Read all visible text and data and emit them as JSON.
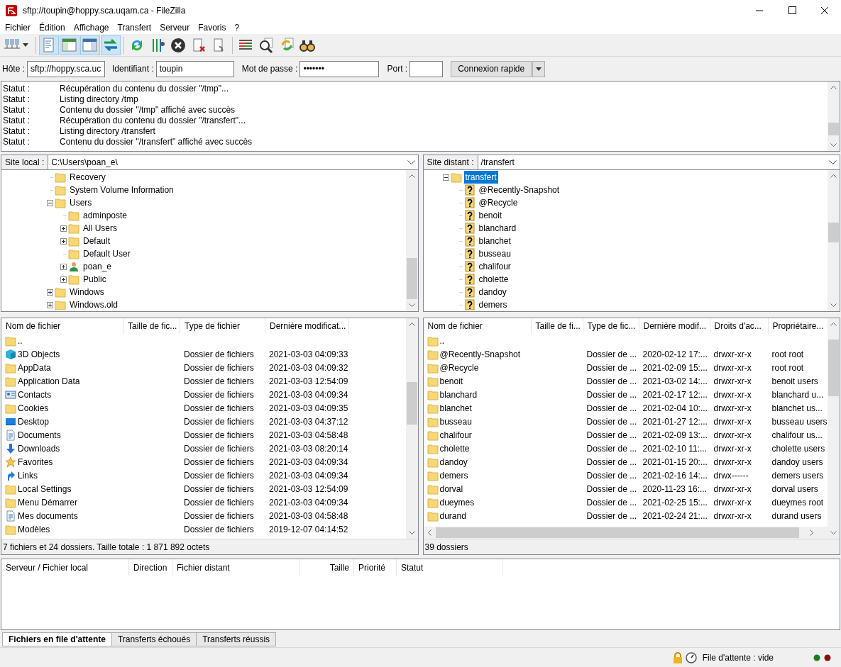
{
  "window": {
    "title": "sftp://toupin@hoppy.sca.uqam.ca - FileZilla"
  },
  "menu": [
    "Fichier",
    "Édition",
    "Affichage",
    "Transfert",
    "Serveur",
    "Favoris",
    "?"
  ],
  "toolbar": [
    {
      "kind": "sitemanager",
      "on": false
    },
    {
      "kind": "log",
      "on": true
    },
    {
      "kind": "localtree",
      "on": true
    },
    {
      "kind": "remotetree",
      "on": true
    },
    {
      "kind": "queue",
      "on": true
    },
    {
      "kind": "refresh",
      "on": false
    },
    {
      "kind": "filters",
      "on": false
    },
    {
      "kind": "cancel",
      "on": false
    },
    {
      "kind": "disconnect",
      "on": false
    },
    {
      "kind": "reconnect",
      "on": false
    },
    {
      "kind": "compare",
      "on": false
    },
    {
      "kind": "search",
      "on": false
    },
    {
      "kind": "sync",
      "on": false
    },
    {
      "kind": "find",
      "on": false
    }
  ],
  "quickconnect": {
    "host_label": "Hôte :",
    "host": "sftp://hoppy.sca.uc",
    "user_label": "Identifiant :",
    "user": "toupin",
    "password_label": "Mot de passe :",
    "password": "•••••••",
    "port_label": "Port :",
    "button": "Connexion rapide"
  },
  "log": [
    {
      "label": "Statut :",
      "message": "Récupération du contenu du dossier \"/tmp\"..."
    },
    {
      "label": "Statut :",
      "message": "Listing directory /tmp"
    },
    {
      "label": "Statut :",
      "message": "Contenu du dossier \"/tmp\" affiché avec succès"
    },
    {
      "label": "Statut :",
      "message": "Récupération du contenu du dossier \"/transfert\"..."
    },
    {
      "label": "Statut :",
      "message": "Listing directory /transfert"
    },
    {
      "label": "Statut :",
      "message": "Contenu du dossier \"/transfert\" affiché avec succès"
    }
  ],
  "local_site": {
    "label": "Site local :",
    "path": "C:\\Users\\poan_e\\",
    "tree": [
      {
        "name": "Recovery",
        "kind": "folder",
        "selected": false
      },
      {
        "name": "System Volume Information",
        "kind": "folder",
        "selected": false
      },
      {
        "name": "Users",
        "kind": "folder",
        "selected": false,
        "expanded": true,
        "children": [
          {
            "name": "adminposte",
            "kind": "folder",
            "selected": false
          },
          {
            "name": "All Users",
            "kind": "folder",
            "selected": false,
            "expanded": false
          },
          {
            "name": "Default",
            "kind": "folder",
            "selected": false,
            "expanded": false
          },
          {
            "name": "Default User",
            "kind": "folder",
            "selected": false
          },
          {
            "name": "poan_e",
            "kind": "user",
            "selected": false,
            "expanded": false
          },
          {
            "name": "Public",
            "kind": "folder",
            "selected": false,
            "expanded": false
          }
        ]
      },
      {
        "name": "Windows",
        "kind": "folder",
        "selected": false,
        "expanded": false
      },
      {
        "name": "Windows.old",
        "kind": "folder",
        "selected": false,
        "expanded": false
      }
    ],
    "columns": [
      "Nom de fichier",
      "Taille de fic...",
      "Type de fichier",
      "Dernière modificat..."
    ],
    "rows": [
      {
        "kind": "folder",
        "name": "..",
        "type": "",
        "modified": ""
      },
      {
        "kind": "cube",
        "name": "3D Objects",
        "type": "Dossier de fichiers",
        "modified": "2021-03-03 04:09:33"
      },
      {
        "kind": "folder",
        "name": "AppData",
        "type": "Dossier de fichiers",
        "modified": "2021-03-03 04:09:32"
      },
      {
        "kind": "folder",
        "name": "Application Data",
        "type": "Dossier de fichiers",
        "modified": "2021-03-03 12:54:09"
      },
      {
        "kind": "contacts",
        "name": "Contacts",
        "type": "Dossier de fichiers",
        "modified": "2021-03-03 04:09:34"
      },
      {
        "kind": "folder",
        "name": "Cookies",
        "type": "Dossier de fichiers",
        "modified": "2021-03-03 04:09:35"
      },
      {
        "kind": "desktop",
        "name": "Desktop",
        "type": "Dossier de fichiers",
        "modified": "2021-03-03 04:37:12"
      },
      {
        "kind": "document",
        "name": "Documents",
        "type": "Dossier de fichiers",
        "modified": "2021-03-03 04:58:48"
      },
      {
        "kind": "download",
        "name": "Downloads",
        "type": "Dossier de fichiers",
        "modified": "2021-03-03 08:20:14"
      },
      {
        "kind": "star",
        "name": "Favorites",
        "type": "Dossier de fichiers",
        "modified": "2021-03-03 04:09:34"
      },
      {
        "kind": "link",
        "name": "Links",
        "type": "Dossier de fichiers",
        "modified": "2021-03-03 04:09:34"
      },
      {
        "kind": "folder",
        "name": "Local Settings",
        "type": "Dossier de fichiers",
        "modified": "2021-03-03 12:54:09"
      },
      {
        "kind": "folder",
        "name": "Menu Démarrer",
        "type": "Dossier de fichiers",
        "modified": "2021-03-03 04:09:34"
      },
      {
        "kind": "document",
        "name": "Mes documents",
        "type": "Dossier de fichiers",
        "modified": "2021-03-03 04:58:48"
      },
      {
        "kind": "folder",
        "name": "Modèles",
        "type": "Dossier de fichiers",
        "modified": "2019-12-07 04:14:52"
      }
    ],
    "summary": "7 fichiers et 24 dossiers. Taille totale : 1 871 892 octets"
  },
  "remote_site": {
    "label": "Site distant :",
    "path": "/transfert",
    "tree": [
      {
        "name": "transfert",
        "kind": "folder",
        "selected": true,
        "expanded": true,
        "children": [
          {
            "name": "@Recently-Snapshot",
            "kind": "unknown",
            "selected": false
          },
          {
            "name": "@Recycle",
            "kind": "unknown",
            "selected": false
          },
          {
            "name": "benoit",
            "kind": "unknown",
            "selected": false
          },
          {
            "name": "blanchard",
            "kind": "unknown",
            "selected": false
          },
          {
            "name": "blanchet",
            "kind": "unknown",
            "selected": false
          },
          {
            "name": "busseau",
            "kind": "unknown",
            "selected": false
          },
          {
            "name": "chalifour",
            "kind": "unknown",
            "selected": false
          },
          {
            "name": "cholette",
            "kind": "unknown",
            "selected": false
          },
          {
            "name": "dandoy",
            "kind": "unknown",
            "selected": false
          },
          {
            "name": "demers",
            "kind": "unknown",
            "selected": false
          }
        ]
      }
    ],
    "columns": [
      "Nom de fichier",
      "Taille de fi...",
      "Type de fic...",
      "Dernière modif...",
      "Droits d'ac...",
      "Propriétaire..."
    ],
    "rows": [
      {
        "name": "..",
        "type": "",
        "modified": "",
        "permissions": "",
        "owner": ""
      },
      {
        "name": "@Recently-Snapshot",
        "type": "Dossier de ...",
        "modified": "2020-02-12 17:...",
        "permissions": "drwxr-xr-x",
        "owner": "root root"
      },
      {
        "name": "@Recycle",
        "type": "Dossier de ...",
        "modified": "2021-02-09 15:...",
        "permissions": "drwxr-xr-x",
        "owner": "root root"
      },
      {
        "name": "benoit",
        "type": "Dossier de ...",
        "modified": "2021-03-02 14:...",
        "permissions": "drwxr-xr-x",
        "owner": "benoit users"
      },
      {
        "name": "blanchard",
        "type": "Dossier de ...",
        "modified": "2021-02-17 12:...",
        "permissions": "drwxr-xr-x",
        "owner": "blanchard u..."
      },
      {
        "name": "blanchet",
        "type": "Dossier de ...",
        "modified": "2021-02-04 10:...",
        "permissions": "drwxr-xr-x",
        "owner": "blanchet us..."
      },
      {
        "name": "busseau",
        "type": "Dossier de ...",
        "modified": "2021-01-27 12:...",
        "permissions": "drwxr-xr-x",
        "owner": "busseau users"
      },
      {
        "name": "chalifour",
        "type": "Dossier de ...",
        "modified": "2021-02-09 13:...",
        "permissions": "drwxr-xr-x",
        "owner": "chalifour us..."
      },
      {
        "name": "cholette",
        "type": "Dossier de ...",
        "modified": "2021-02-10 11:...",
        "permissions": "drwxr-xr-x",
        "owner": "cholette users"
      },
      {
        "name": "dandoy",
        "type": "Dossier de ...",
        "modified": "2021-01-15 20:...",
        "permissions": "drwxr-xr-x",
        "owner": "dandoy users"
      },
      {
        "name": "demers",
        "type": "Dossier de ...",
        "modified": "2021-02-16 14:...",
        "permissions": "drwx------",
        "owner": "demers users"
      },
      {
        "name": "dorval",
        "type": "Dossier de ...",
        "modified": "2020-11-23 16:...",
        "permissions": "drwxr-xr-x",
        "owner": "dorval users"
      },
      {
        "name": "dueymes",
        "type": "Dossier de ...",
        "modified": "2021-02-25 15:...",
        "permissions": "drwxr-xr-x",
        "owner": "dueymes root"
      },
      {
        "name": "durand",
        "type": "Dossier de ...",
        "modified": "2021-02-24 21:...",
        "permissions": "drwxr-xr-x",
        "owner": "durand users"
      }
    ],
    "summary": "39 dossiers"
  },
  "queue": {
    "columns": [
      "Serveur / Fichier local",
      "Direction",
      "Fichier distant",
      "Taille",
      "Priorité",
      "Statut"
    ],
    "tabs": [
      {
        "label": "Fichiers en file d'attente",
        "selected": true
      },
      {
        "label": "Transferts échoués",
        "selected": false
      },
      {
        "label": "Transferts réussis",
        "selected": false
      }
    ]
  },
  "status_bar": {
    "queue": "File d'attente : vide"
  }
}
